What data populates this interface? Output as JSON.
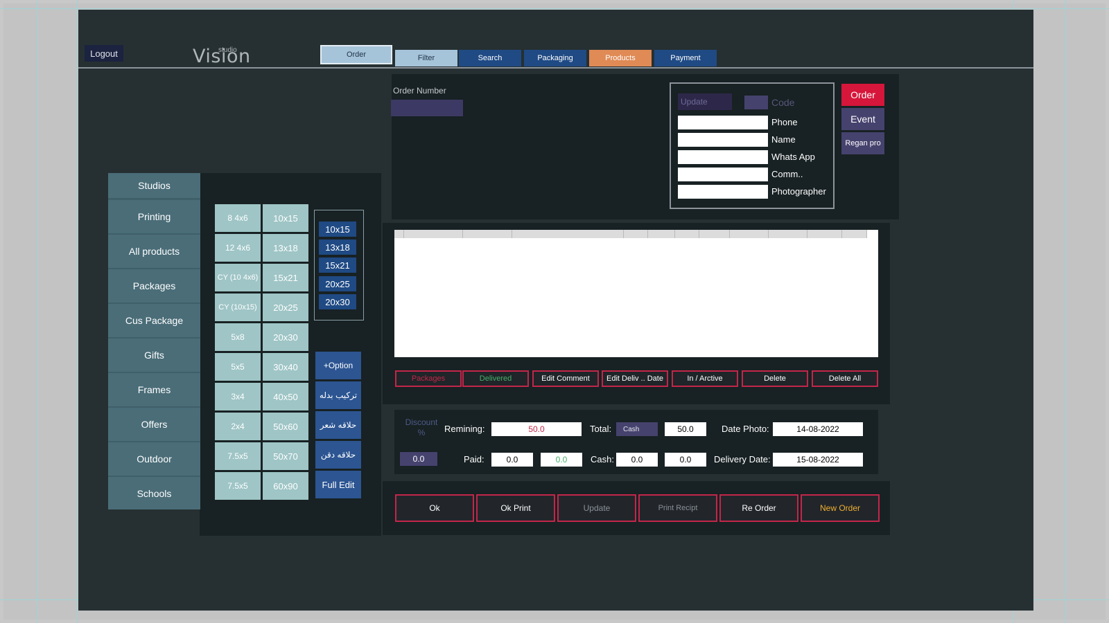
{
  "logout_label": "Logout",
  "logo": {
    "small": "studio",
    "big": "Vision"
  },
  "tabs": {
    "order": "Order",
    "filter": "Filter",
    "search": "Search",
    "packaging": "Packaging",
    "products": "Products",
    "payment": "Payment"
  },
  "categories": [
    "Studios",
    "Printing",
    "All products",
    "Packages",
    "Cus Package",
    "Gifts",
    "Frames",
    "Offers",
    "Outdoor",
    "Schools"
  ],
  "sizes_col1": [
    "8 4x6",
    "12 4x6",
    "CY (10 4x6)",
    "CY (10x15)",
    "5x8",
    "5x5",
    "3x4",
    "2x4",
    "7.5x5",
    "7.5x5"
  ],
  "sizes_col2": [
    "10x15",
    "13x18",
    "15x21",
    "20x25",
    "20x30",
    "30x40",
    "40x50",
    "50x60",
    "50x70",
    "60x90"
  ],
  "sizes_box": [
    "10x15",
    "13x18",
    "15x21",
    "20x25",
    "20x30"
  ],
  "options": [
    "+Option",
    "تركيب بدله",
    "حلاقه شعر",
    "حلاقه دقن",
    "Full Edit"
  ],
  "order": {
    "number_label": "Order Number",
    "update_label": "Update",
    "code_label": "Code",
    "field_labels": [
      "Phone",
      "Name",
      "Whats App",
      "Comm..",
      "Photographer"
    ]
  },
  "side_buttons": [
    "Order",
    "Event",
    "Regan pro"
  ],
  "actions": [
    "Packages",
    "Delivered",
    "Edit Comment",
    "Edit Deliv .. Date",
    "In / Arctive",
    "Delete",
    "Delete All"
  ],
  "payment": {
    "discount_label": "Discount %",
    "discount_value": "0.0",
    "remaining_label": "Remining:",
    "remaining_value": "50.0",
    "total_label": "Total:",
    "cash_select": "Cash",
    "total_value": "50.0",
    "date_photo_label": "Date Photo:",
    "date_photo_value": "14-08-2022",
    "paid_label": "Paid:",
    "paid_value": "0.0",
    "paid_value2": "0.0",
    "cash_label": "Cash:",
    "cash_value": "0.0",
    "cash_value2": "0.0",
    "delivery_label": "Delivery Date:",
    "delivery_value": "15-08-2022"
  },
  "bottom_buttons": [
    "Ok",
    "Ok Print",
    "Update",
    "Print Recipt",
    "Re Order",
    "New Order"
  ],
  "colors": {
    "accent_red": "#c3264a",
    "products_tab": "#e08a55",
    "nav_blue": "#1f4a84",
    "teal": "#4a6d78"
  }
}
